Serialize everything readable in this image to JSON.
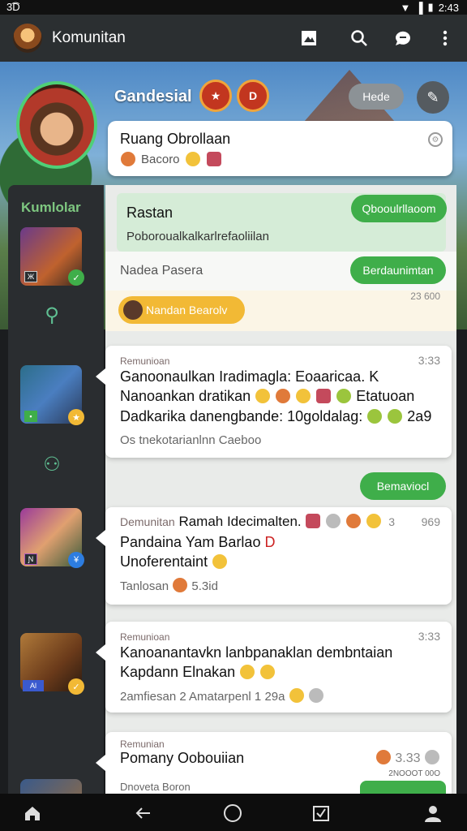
{
  "status": {
    "left": "3͡D",
    "time": "2:43"
  },
  "appbar": {
    "title": "Komunitan"
  },
  "header": {
    "group_name": "Gandesial",
    "badge1": "★",
    "badge2": "D",
    "pill_button": "Hede",
    "room_title": "Ruang Obrollaan",
    "room_sub": "Bacoro"
  },
  "sidebar": {
    "label": "Kumlolar"
  },
  "notice": {
    "title": "Rastan",
    "subtitle": "Poboroualkalkarlrefaoliilan",
    "button1": "Qbooulrllaoom",
    "name": "Nadea Pasera",
    "button2": "Berdaunimtan",
    "time": "23 600",
    "pill": "Nandan Bearolv"
  },
  "messages": [
    {
      "who": "Remunioan",
      "time": "3:33",
      "line1": "Ganoonaulkan Iradimagla: Eoaaricaa. K",
      "line2": "Nanoankan dratikan",
      "line2b": "Etatuoan",
      "line3": "Dadkarika danengbande: 10goldalag:",
      "line3b": "2a9",
      "meta": "Os tnekotarianlnn Caeboo"
    },
    {
      "who": "Demunitan",
      "head": "Ramah Idecimalten.",
      "time": "3",
      "time2": "969",
      "line1": "Pandaina Yam Barlao",
      "line1b": "D",
      "line2": "Unoferentaint",
      "meta": "Tanlosan",
      "meta_b": "5.3id",
      "green_button": "Bemaviocl"
    },
    {
      "who": "Remunioan",
      "time": "3:33",
      "line1": "Kanoanantavkn lanbpanaklan dembntaian",
      "line2": "Kapdann Elnakan",
      "meta": "2amfiesan 2 Amatarpenl 1 29a"
    },
    {
      "who": "Remunian",
      "line1": "Pomany Oobouiian",
      "time": "3.33",
      "meta": "Dnoveta Boron",
      "meta_r": "2NOOOT 00O"
    }
  ],
  "colors": {
    "accent_green": "#3fae4a",
    "appbar": "#2b2f31",
    "yellow": "#f2b935"
  }
}
